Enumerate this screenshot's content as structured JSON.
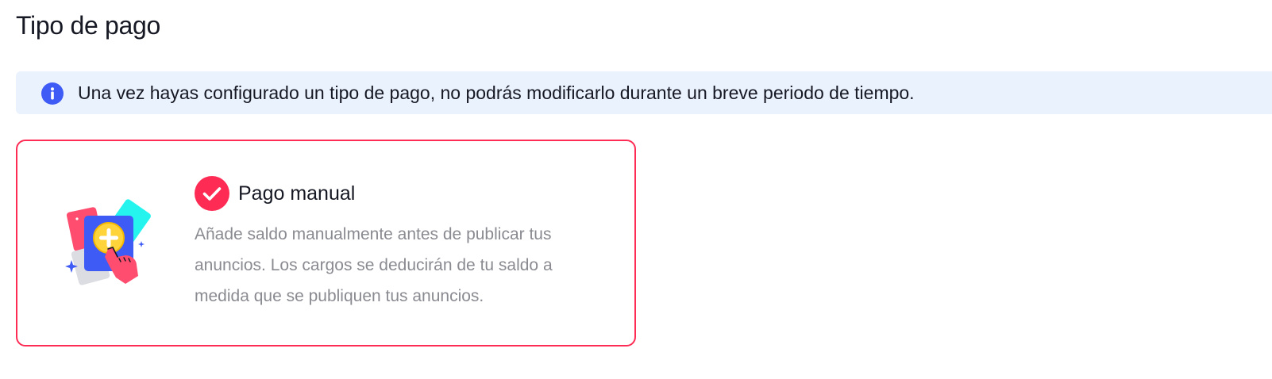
{
  "header": {
    "title": "Tipo de pago"
  },
  "info_banner": {
    "icon": "info-icon",
    "text": "Una vez hayas configurado un tipo de pago, no podrás modificarlo durante un breve periodo de tiempo."
  },
  "payment_option": {
    "selected": true,
    "icon": "checkmark-icon",
    "illustration": "add-funds-illustration",
    "title": "Pago manual",
    "description": "Añade saldo manualmente antes de publicar tus anuncios. Los cargos se deducirán de tu saldo a medida que se publiquen tus anuncios."
  },
  "colors": {
    "accent": "#fe2c55",
    "info_icon": "#3f5bf5",
    "banner_bg": "#eaf2fd",
    "text_primary": "#161823",
    "text_secondary": "#8a8b91"
  }
}
